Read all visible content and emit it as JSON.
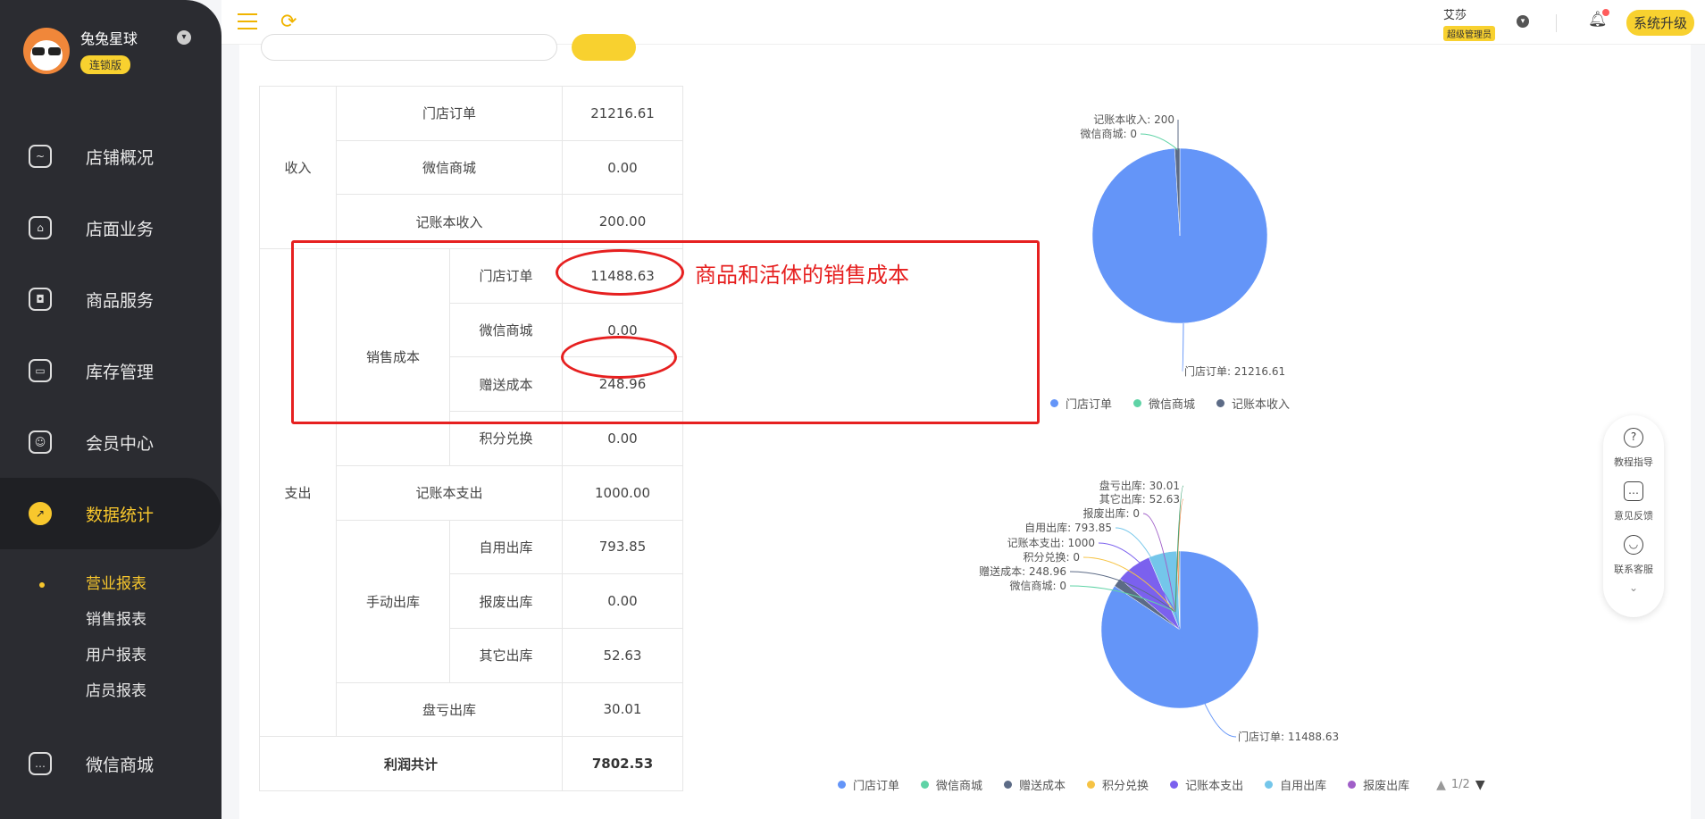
{
  "profile": {
    "name": "兔兔星球",
    "badge": "连锁版"
  },
  "sidebar": {
    "items": [
      {
        "label": "店铺概况",
        "icon": "monitor-icon"
      },
      {
        "label": "店面业务",
        "icon": "home-icon"
      },
      {
        "label": "商品服务",
        "icon": "bag-icon"
      },
      {
        "label": "库存管理",
        "icon": "box-icon"
      },
      {
        "label": "会员中心",
        "icon": "member-icon"
      },
      {
        "label": "数据统计",
        "icon": "chart-icon"
      }
    ],
    "sub_items": [
      {
        "label": "营业报表"
      },
      {
        "label": "销售报表"
      },
      {
        "label": "用户报表"
      },
      {
        "label": "店员报表"
      }
    ],
    "bottom_item": {
      "label": "微信商城",
      "icon": "chat-icon"
    }
  },
  "header": {
    "user_name": "艾莎",
    "user_role": "超级管理员",
    "upgrade_label": "系统升级"
  },
  "report": {
    "income_label": "收入",
    "expense_label": "支出",
    "sales_cost_label": "销售成本",
    "manual_out_label": "手动出库",
    "rows": {
      "store_order": {
        "label": "门店订单",
        "value": "21216.61"
      },
      "wechat_mall": {
        "label": "微信商城",
        "value": "0.00"
      },
      "ledger_income": {
        "label": "记账本收入",
        "value": "200.00"
      },
      "cost_store_order": {
        "label": "门店订单",
        "value": "11488.63"
      },
      "cost_wechat_mall": {
        "label": "微信商城",
        "value": "0.00"
      },
      "gift_cost": {
        "label": "赠送成本",
        "value": "248.96"
      },
      "points_exchange": {
        "label": "积分兑换",
        "value": "0.00"
      },
      "ledger_expense": {
        "label": "记账本支出",
        "value": "1000.00"
      },
      "self_use_out": {
        "label": "自用出库",
        "value": "793.85"
      },
      "scrap_out": {
        "label": "报废出库",
        "value": "0.00"
      },
      "other_out": {
        "label": "其它出库",
        "value": "52.63"
      },
      "loss_out": {
        "label": "盘亏出库",
        "value": "30.01"
      },
      "total": {
        "label": "利润共计",
        "value": "7802.53"
      }
    }
  },
  "annotation": {
    "note": "商品和活体的销售成本"
  },
  "chart_data": [
    {
      "type": "pie",
      "series": [
        {
          "values": [
            21216.61,
            0,
            200
          ]
        }
      ],
      "categories": [
        "门店订单",
        "微信商城",
        "记账本收入"
      ],
      "colors": [
        "#6495f8",
        "#5fd3a6",
        "#5c6b86"
      ],
      "labels": [
        "门店订单: 21216.61",
        "微信商城: 0",
        "记账本收入: 200"
      ],
      "legend": [
        "门店订单",
        "微信商城",
        "记账本收入"
      ],
      "legend_position": "bottom"
    },
    {
      "type": "pie",
      "series": [
        {
          "values": [
            11488.63,
            0,
            248.96,
            0,
            1000,
            793.85,
            0,
            52.63,
            30.01
          ]
        }
      ],
      "categories": [
        "门店订单",
        "微信商城",
        "赠送成本",
        "积分兑换",
        "记账本支出",
        "自用出库",
        "报废出库",
        "其它出库",
        "盘亏出库"
      ],
      "colors": [
        "#6495f8",
        "#5fd3a6",
        "#5c6b86",
        "#f6c344",
        "#7b61ee",
        "#74c6ea",
        "#a05fc8",
        "#f08a4b",
        "#3ba272"
      ],
      "labels": [
        "门店订单: 11488.63",
        "微信商城: 0",
        "赠送成本: 248.96",
        "积分兑换: 0",
        "记账本支出: 1000",
        "自用出库: 793.85",
        "报废出库: 0",
        "其它出库: 52.63",
        "盘亏出库: 30.01"
      ],
      "legend": [
        "门店订单",
        "微信商城",
        "赠送成本",
        "积分兑换",
        "记账本支出",
        "自用出库",
        "报废出库"
      ],
      "legend_page": "1/2",
      "legend_position": "bottom"
    }
  ],
  "float_panel": {
    "items": [
      {
        "label": "教程指导",
        "icon": "help-icon"
      },
      {
        "label": "意见反馈",
        "icon": "feedback-icon"
      },
      {
        "label": "联系客服",
        "icon": "service-icon"
      }
    ]
  }
}
